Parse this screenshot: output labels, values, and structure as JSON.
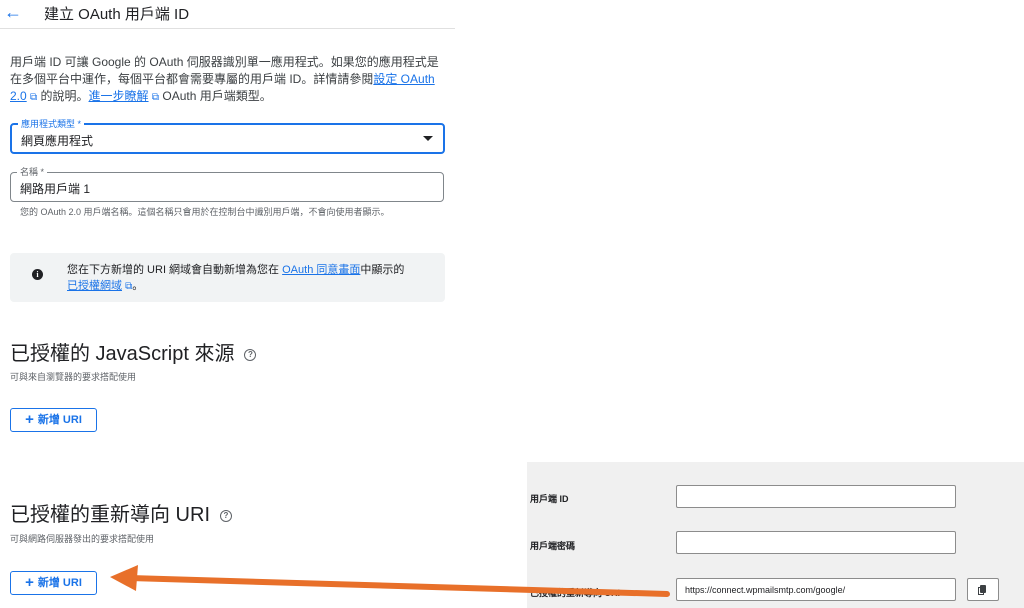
{
  "header": {
    "back_icon": "arrow-left-icon",
    "title": "建立 OAuth 用戶端 ID"
  },
  "intro": {
    "text1": "用戶端 ID 可讓 Google 的 OAuth 伺服器識別單一應用程式。如果您的應用程式是在多個平台中運作，每個平台都會需要專屬的用戶端 ID。詳情請參閱",
    "link1": "設定 OAuth 2.0",
    "text2": "的說明。",
    "link2": "進一步瞭解",
    "text3": "OAuth 用戶端類型。"
  },
  "app_type": {
    "label": "應用程式類型 *",
    "value": "網頁應用程式"
  },
  "name_field": {
    "label": "名稱 *",
    "value": "網路用戶端 1",
    "hint": "您的 OAuth 2.0 用戶端名稱。這個名稱只會用於在控制台中識別用戶端，不會向使用者顯示。"
  },
  "info_box": {
    "text1": "您在下方新增的 URI 網域會自動新增為您在",
    "link1": "OAuth 同意畫面",
    "text2": "中顯示的",
    "link2": "已授權網域",
    "text3": "。"
  },
  "js_origins": {
    "title": "已授權的 JavaScript 來源",
    "subtitle": "可與來自瀏覽器的要求搭配使用",
    "button": "新增 URI"
  },
  "redirect_uris": {
    "title": "已授權的重新導向 URI",
    "subtitle": "可與網路伺服器發出的要求搭配使用",
    "button": "新增 URI"
  },
  "panel": {
    "client_id_label": "用戶端 ID",
    "client_id_value": "",
    "client_secret_label": "用戶端密碼",
    "client_secret_value": "",
    "redirect_label": "已授權的重新導向 URI",
    "redirect_value": "https://connect.wpmailsmtp.com/google/"
  },
  "colors": {
    "accent": "#1a73e8",
    "arrow": "#e8702a"
  }
}
